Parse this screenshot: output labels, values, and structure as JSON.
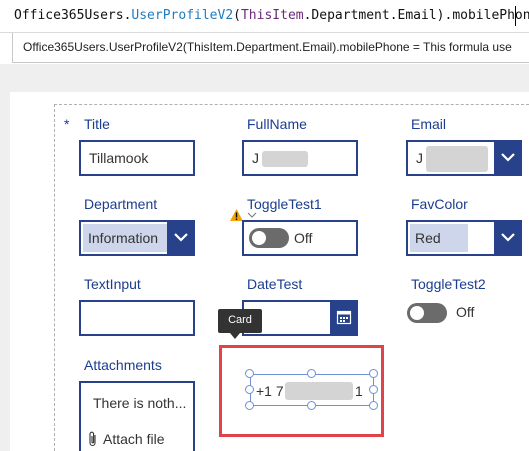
{
  "formula_bar": {
    "parts": [
      {
        "text": "Office365Users.",
        "style": "plain"
      },
      {
        "text": "UserProfileV2",
        "style": "fn"
      },
      {
        "text": "(",
        "style": "plain"
      },
      {
        "text": "ThisItem",
        "style": "kw"
      },
      {
        "text": ".Department.Email).mobilePhone",
        "style": "plain"
      }
    ]
  },
  "hint": {
    "text": "Office365Users.UserProfileV2(ThisItem.Department.Email).mobilePhone  =  This formula use"
  },
  "form": {
    "required_marker": "*",
    "title": {
      "label": "Title",
      "value": "Tillamook"
    },
    "fullname": {
      "label": "FullName",
      "value": "J"
    },
    "email": {
      "label": "Email",
      "value": "J"
    },
    "department": {
      "label": "Department",
      "value": "Information"
    },
    "toggle_test1": {
      "label": "ToggleTest1",
      "state": "Off"
    },
    "fav_color": {
      "label": "FavColor",
      "value": "Red"
    },
    "text_input": {
      "label": "TextInput",
      "value": ""
    },
    "date_test": {
      "label": "DateTest",
      "value": ""
    },
    "toggle_test2": {
      "label": "ToggleTest2",
      "state": "Off"
    },
    "attachments": {
      "label": "Attachments",
      "empty_text": "There is noth...",
      "attach_label": "Attach file"
    }
  },
  "tooltip": {
    "text": "Card"
  },
  "phone_card": {
    "prefix": "+1 7",
    "suffix": "1"
  },
  "colors": {
    "control_border": "#27418a",
    "label_text": "#1b3d8f",
    "highlight_frame": "#e0434a",
    "selection": "#6f8fd6",
    "warning": "#f0a30a"
  }
}
